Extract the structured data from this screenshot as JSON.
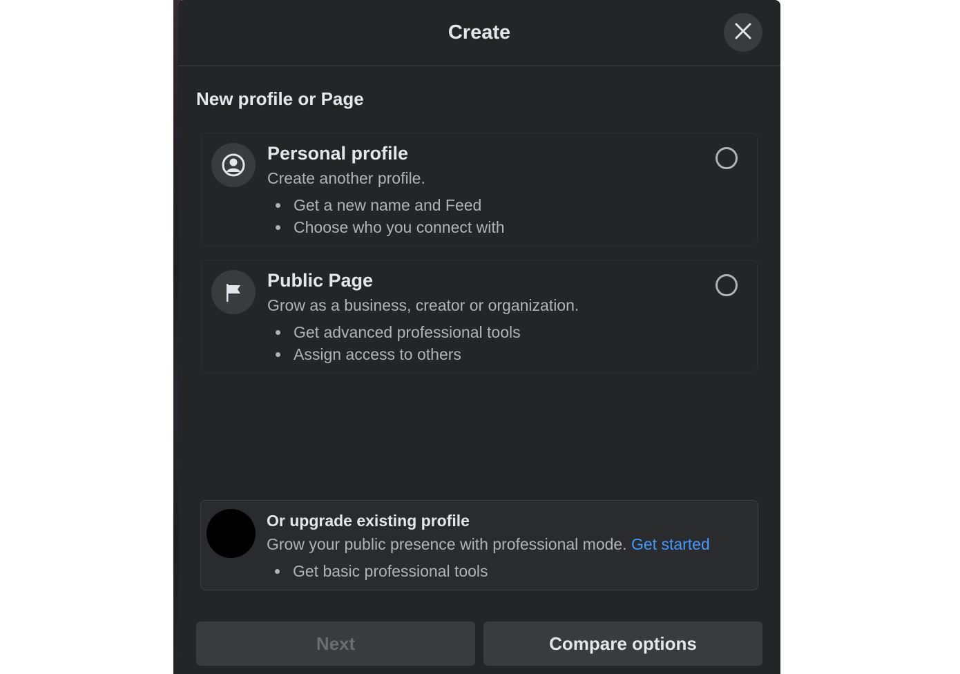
{
  "dialog": {
    "title": "Create"
  },
  "section": {
    "label": "New profile or Page"
  },
  "options": [
    {
      "icon": "user-circle-icon",
      "title": "Personal profile",
      "description": "Create another profile.",
      "bullets": [
        "Get a new name and Feed",
        "Choose who you connect with"
      ],
      "selected": false
    },
    {
      "icon": "flag-icon",
      "title": "Public Page",
      "description": "Grow as a business, creator or organization.",
      "bullets": [
        "Get advanced professional tools",
        "Assign access to others"
      ],
      "selected": false
    }
  ],
  "upgrade": {
    "title": "Or upgrade existing profile",
    "description": "Grow your public presence with professional mode.",
    "link": "Get started",
    "bullets": [
      "Get basic professional tools"
    ]
  },
  "footer": {
    "next_label": "Next",
    "compare_label": "Compare options"
  },
  "colors": {
    "modal_bg": "#242526",
    "surface": "#3a3b3c",
    "primary_text": "#e4e6eb",
    "secondary_text": "#b0b3b8",
    "link": "#4599ff"
  }
}
